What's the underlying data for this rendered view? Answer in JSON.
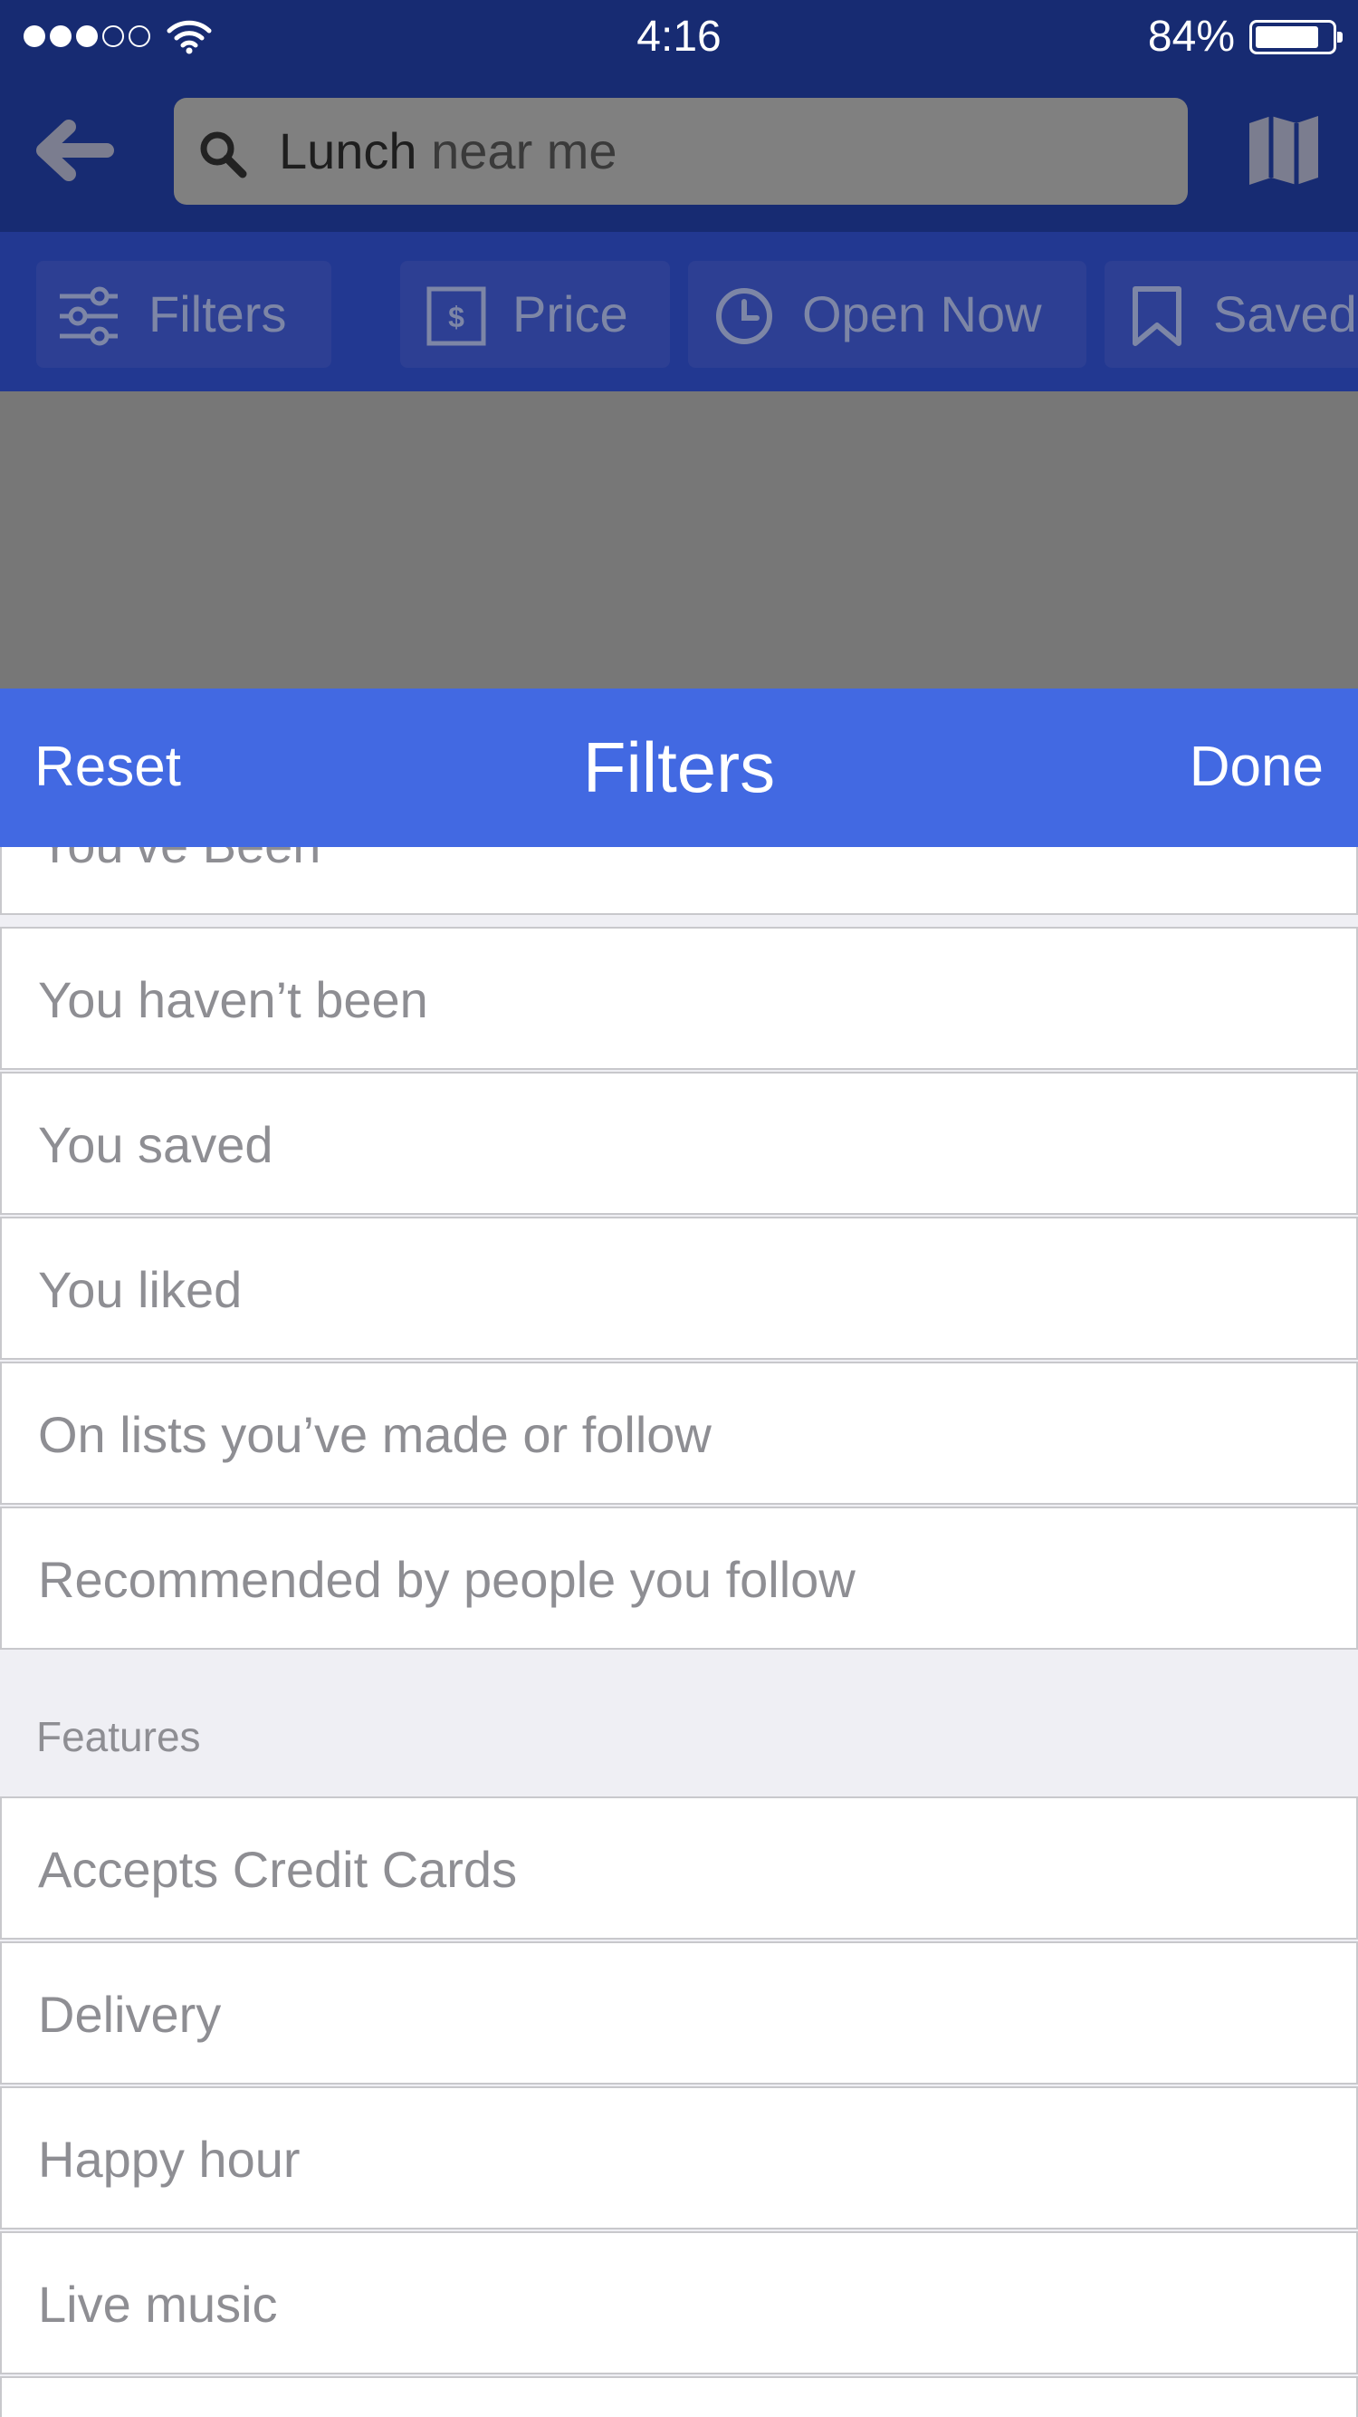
{
  "status_bar": {
    "time": "4:16",
    "battery_percent": "84%",
    "battery_level": 0.84,
    "signal_bars_filled": 3,
    "signal_bars_total": 5
  },
  "nav": {
    "search_query": "Lunch",
    "search_placeholder": "near me"
  },
  "filter_chips": [
    {
      "label": "Filters",
      "icon": "sliders-icon"
    },
    {
      "label": "Price",
      "icon": "dollar-icon"
    },
    {
      "label": "Open Now",
      "icon": "clock-icon"
    },
    {
      "label": "Saved",
      "icon": "bookmark-icon"
    }
  ],
  "sheet": {
    "reset_label": "Reset",
    "title": "Filters",
    "done_label": "Done"
  },
  "list": {
    "partial_item": "You’ve Been",
    "personal_items": [
      "You haven’t been",
      "You saved",
      "You liked",
      "On lists you’ve made or follow",
      "Recommended by people you follow"
    ],
    "features_header": "Features",
    "features_items": [
      "Accepts Credit Cards",
      "Delivery",
      "Happy hour",
      "Live music"
    ]
  },
  "colors": {
    "nav_bg": "#172b72",
    "sheet_header_bg": "#4269e2",
    "list_text": "#8e8e93"
  }
}
